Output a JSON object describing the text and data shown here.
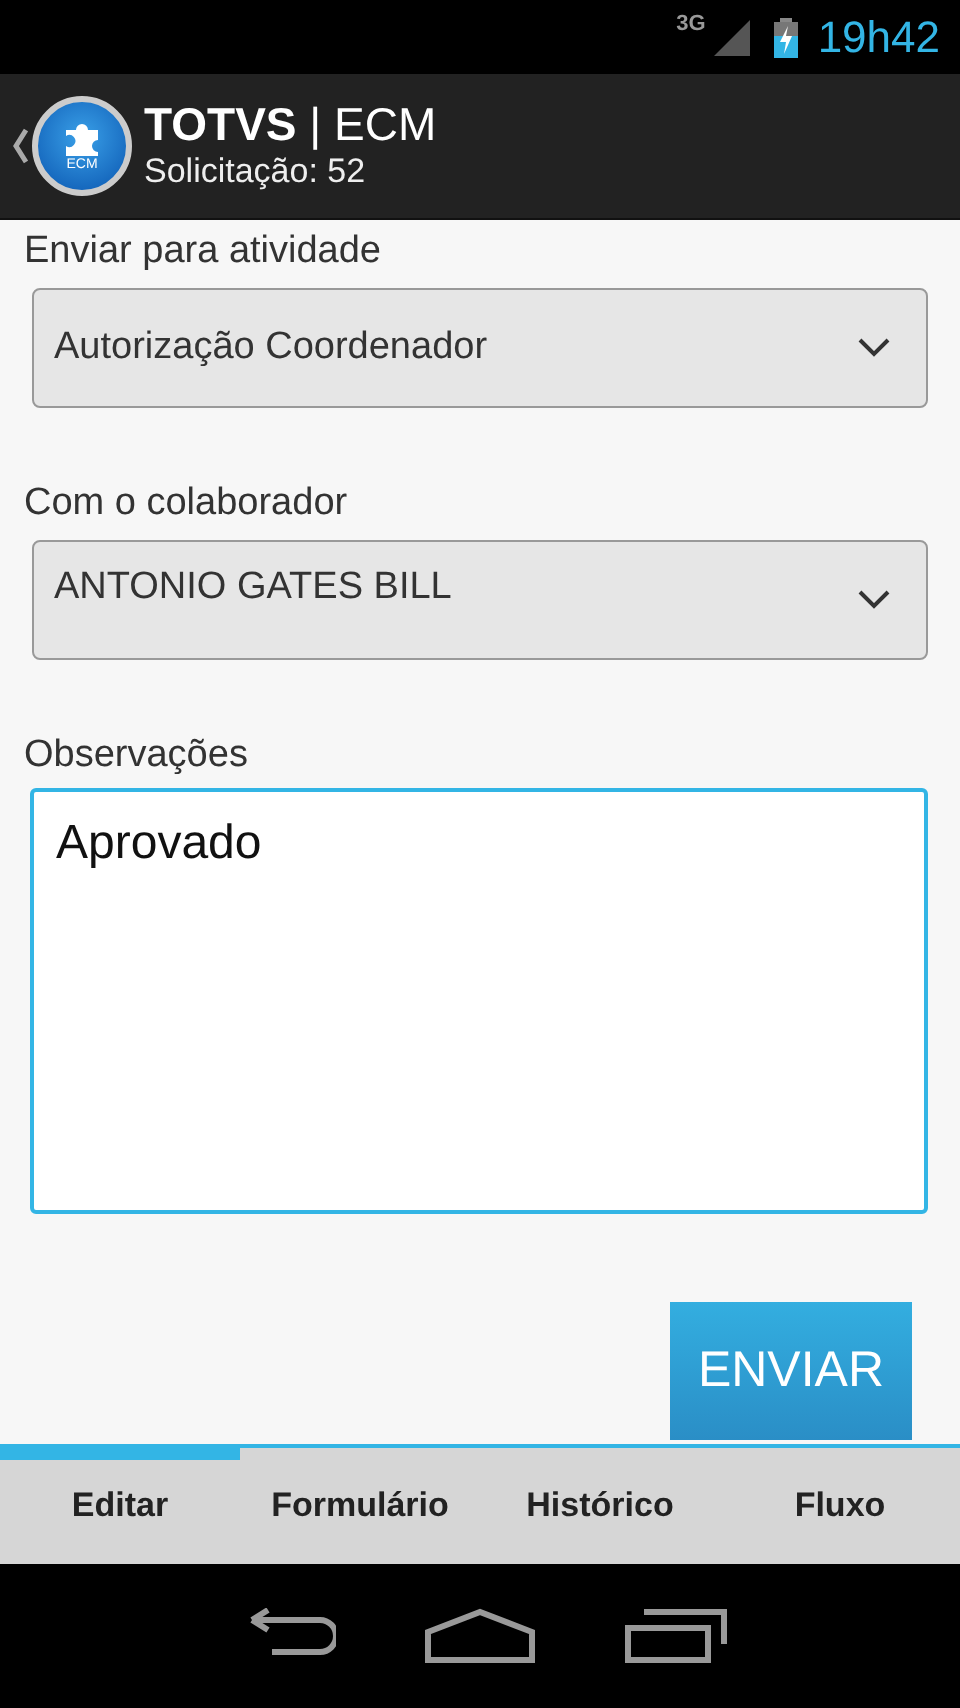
{
  "status_bar": {
    "network": "3G",
    "time": "19h42"
  },
  "action_bar": {
    "logo_text": "ECM",
    "title_bold": "TOTVS",
    "title_rest": "| ECM",
    "subtitle": "Solicitação: 52"
  },
  "fields": [
    {
      "kind": "dropdown",
      "label": "Enviar para atividade",
      "value": "Autorização Coordenador"
    },
    {
      "kind": "dropdown",
      "label": "Com o colaborador",
      "value": "ANTONIO GATES BILL"
    },
    {
      "kind": "textarea",
      "label": "Observações",
      "value": "Aprovado"
    }
  ],
  "send_button": "ENVIAR",
  "tabs": [
    {
      "label": "Editar",
      "selected": true
    },
    {
      "label": "Formulário",
      "selected": false
    },
    {
      "label": "Histórico",
      "selected": false
    },
    {
      "label": "Fluxo",
      "selected": false
    }
  ]
}
